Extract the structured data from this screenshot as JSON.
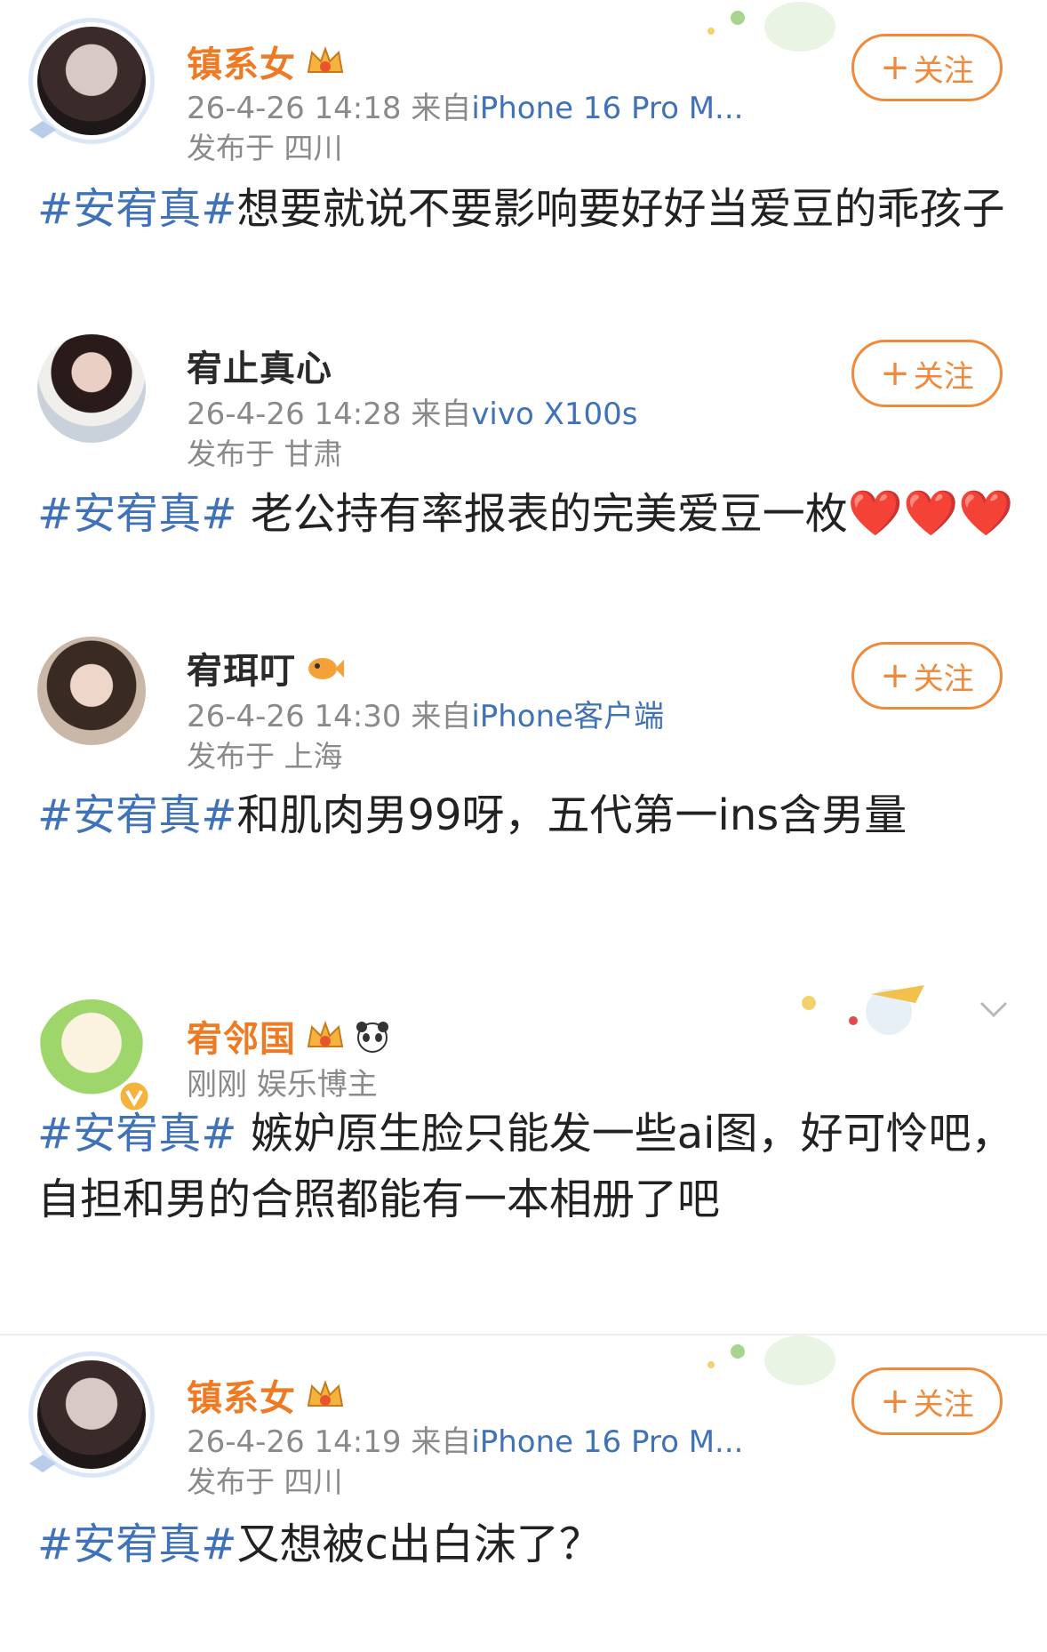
{
  "follow_label": "关注",
  "follow_plus": "+",
  "posts": [
    {
      "name": "镇系女",
      "time": "26-4-26 14:18",
      "from_prefix": "来自",
      "source": "iPhone 16 Pro M...",
      "location": "发布于 四川",
      "tag": "#安宥真#",
      "text": "想要就说不要影响要好好当爱豆的乖孩子"
    },
    {
      "name": "宥止真心",
      "time": "26-4-26 14:28",
      "from_prefix": "来自",
      "source": "vivo X100s",
      "location": "发布于 甘肃",
      "tag": "#安宥真#",
      "text": " 老公持有率报表的完美爱豆一枚",
      "hearts": "❤️❤️❤️"
    },
    {
      "name": "宥珥叮",
      "time": "26-4-26 14:30",
      "from_prefix": "来自",
      "source": "iPhone客户端",
      "location": "发布于 上海",
      "tag": "#安宥真#",
      "text": "和肌肉男99呀，五代第一ins含男量"
    },
    {
      "name": "宥邻国",
      "time": "刚刚",
      "role": "娱乐博主",
      "tag": "#安宥真#",
      "text": " 嫉妒原生脸只能发一些ai图，好可怜吧，自担和男的合照都能有一本相册了吧"
    },
    {
      "name": "镇系女",
      "time": "26-4-26 14:19",
      "from_prefix": "来自",
      "source": "iPhone 16 Pro M...",
      "location": "发布于 四川",
      "tag": "#安宥真#",
      "text": "又想被c出白沫了？"
    }
  ],
  "colors": {
    "accent_orange": "#f08a3a",
    "vip_name": "#ee7b24",
    "link_blue": "#3f72b8",
    "meta_gray": "#8a8a8a"
  },
  "icons": [
    "crown-badge-icon",
    "panda-icon",
    "verified-v-icon",
    "chevron-down-icon",
    "plus-icon"
  ]
}
